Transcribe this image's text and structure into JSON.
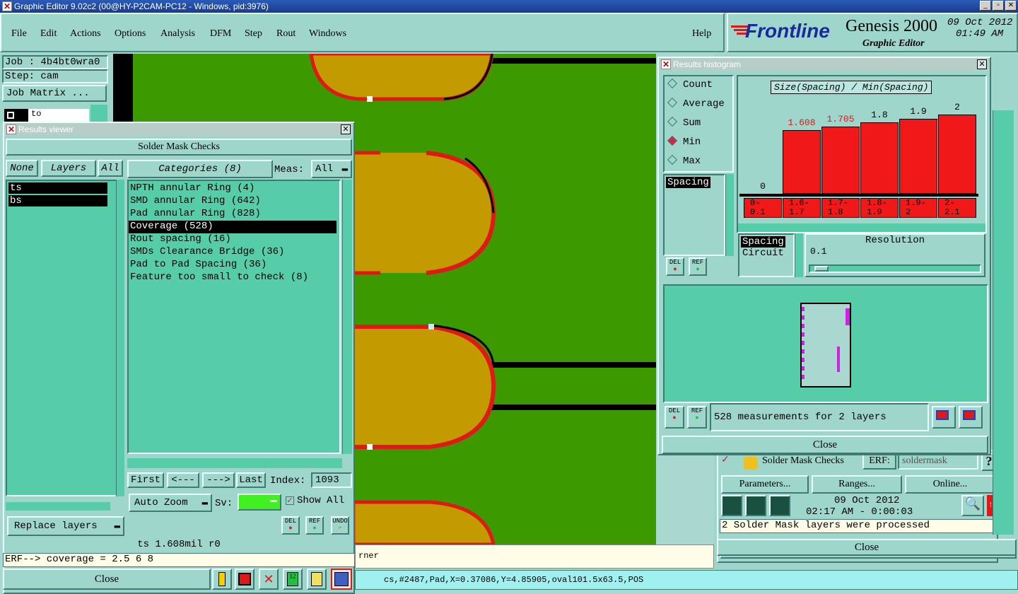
{
  "window": {
    "title": "Graphic Editor 9.02c2 (00@HY-P2CAM-PC12 - Windows, pid:3976)"
  },
  "menu": [
    "File",
    "Edit",
    "Actions",
    "Options",
    "Analysis",
    "DFM",
    "Step",
    "Rout",
    "Windows"
  ],
  "help": "Help",
  "logo": {
    "brand": "Frontline",
    "product": "Genesis 2000",
    "subtitle": "Graphic Editor",
    "date": "09 Oct 2012",
    "time": "01:49 AM"
  },
  "left": {
    "job": "Job : 4b4bt0wra0",
    "step": "Step: cam",
    "job_matrix": "Job Matrix ...",
    "to": "to"
  },
  "results_viewer": {
    "title": "Results viewer",
    "header": "Solder Mask Checks",
    "none": "None",
    "layers": "Layers",
    "all": "All",
    "categories": "Categories (8)",
    "meas_label": "Meas:",
    "meas_value": "All",
    "layer_items": [
      "ts",
      "bs"
    ],
    "category_items": [
      "NPTH annular Ring (4)",
      "SMD annular Ring (642)",
      "Pad annular Ring (828)",
      "Coverage (528)",
      "Rout spacing (16)",
      "SMDs Clearance Bridge (36)",
      "Pad to Pad Spacing (36)",
      "Feature too small to check (8)"
    ],
    "first": "First",
    "prev": "<---",
    "next": "--->",
    "last": "Last",
    "index_label": "Index:",
    "index_value": "1093",
    "auto_zoom": "Auto Zoom",
    "sv": "Sv:",
    "show_all": "Show All",
    "replace_layers": "Replace layers",
    "del": "DEL",
    "ref": "REF",
    "undo": "UNDO",
    "status": "ts 1.608mil  r0",
    "erf": "ERF--> coverage = 2.5 6 8",
    "close": "Close"
  },
  "histogram": {
    "title": "Results histogram",
    "modes": [
      "Count",
      "Average",
      "Sum",
      "Min",
      "Max"
    ],
    "selected_mode": "Min",
    "chart_title": "Size(Spacing) / Min(Spacing)",
    "bars": [
      {
        "range": "0-\n0.1",
        "label": "0",
        "value": 0,
        "red": false
      },
      {
        "range": "1.6-\n1.7",
        "label": "1.608",
        "value": 1.608,
        "red": true
      },
      {
        "range": "1.7-\n1.8",
        "label": "1.705",
        "value": 1.705,
        "red": true
      },
      {
        "range": "1.8-\n1.9",
        "label": "1.8",
        "value": 1.8,
        "red": false
      },
      {
        "range": "1.9-\n2",
        "label": "1.9",
        "value": 1.9,
        "red": false
      },
      {
        "range": "2-\n2.1",
        "label": "2",
        "value": 2,
        "red": false
      }
    ],
    "spacing": "Spacing",
    "list2": [
      "Spacing",
      "Circuit"
    ],
    "resolution_label": "Resolution",
    "resolution_value": "0.1",
    "measurements": "528 measurements for 2 layers",
    "close": "Close"
  },
  "erf_panel": {
    "name": "Solder Mask Checks",
    "erf_label": "ERF:",
    "erf_value": "soldermask",
    "parameters": "Parameters...",
    "ranges": "Ranges...",
    "online": "Online...",
    "date": "09 Oct 2012",
    "time": "02:17 AM - 0:00:03",
    "message": "2 Solder Mask layers were processed",
    "close": "Close"
  },
  "bottom_status": "cs,#2487,Pad,X=0.37086,Y=4.85905,oval101.5x63.5,POS",
  "corner_text": "rner",
  "colors": {
    "panel": "#9ed6cc",
    "list": "#56cca8",
    "canvas": "#3c9a00",
    "pad": "#c39a00",
    "accent": "#f01818"
  }
}
